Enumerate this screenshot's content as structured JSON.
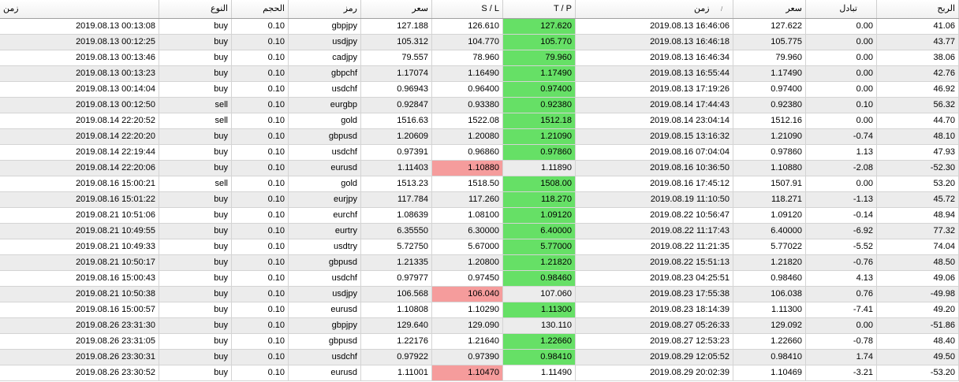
{
  "headers": {
    "open_time": "زمن",
    "type": "النوع",
    "volume": "الحجم",
    "symbol": "رمز",
    "open_price": "سعر",
    "sl": "S / L",
    "tp": "T / P",
    "close_time": "زمن",
    "close_price": "سعر",
    "swap": "تبادل",
    "profit": "الربح"
  },
  "sort_indicator": "/",
  "colors": {
    "tp_hit": "#66e066",
    "sl_hit": "#f59c9c",
    "alt_row": "#ececec"
  },
  "rows": [
    {
      "open_time": "2019.08.13 00:13:08",
      "type": "buy",
      "volume": "0.10",
      "symbol": "gbpjpy",
      "open_price": "127.188",
      "sl": "126.610",
      "tp": "127.620",
      "close_time": "2019.08.13 16:46:06",
      "close_price": "127.622",
      "swap": "0.00",
      "profit": "41.06",
      "hit": "tp"
    },
    {
      "open_time": "2019.08.13 00:12:25",
      "type": "buy",
      "volume": "0.10",
      "symbol": "usdjpy",
      "open_price": "105.312",
      "sl": "104.770",
      "tp": "105.770",
      "close_time": "2019.08.13 16:46:18",
      "close_price": "105.775",
      "swap": "0.00",
      "profit": "43.77",
      "hit": "tp"
    },
    {
      "open_time": "2019.08.13 00:13:46",
      "type": "buy",
      "volume": "0.10",
      "symbol": "cadjpy",
      "open_price": "79.557",
      "sl": "78.960",
      "tp": "79.960",
      "close_time": "2019.08.13 16:46:34",
      "close_price": "79.960",
      "swap": "0.00",
      "profit": "38.06",
      "hit": "tp"
    },
    {
      "open_time": "2019.08.13 00:13:23",
      "type": "buy",
      "volume": "0.10",
      "symbol": "gbpchf",
      "open_price": "1.17074",
      "sl": "1.16490",
      "tp": "1.17490",
      "close_time": "2019.08.13 16:55:44",
      "close_price": "1.17490",
      "swap": "0.00",
      "profit": "42.76",
      "hit": "tp"
    },
    {
      "open_time": "2019.08.13 00:14:04",
      "type": "buy",
      "volume": "0.10",
      "symbol": "usdchf",
      "open_price": "0.96943",
      "sl": "0.96400",
      "tp": "0.97400",
      "close_time": "2019.08.13 17:19:26",
      "close_price": "0.97400",
      "swap": "0.00",
      "profit": "46.92",
      "hit": "tp"
    },
    {
      "open_time": "2019.08.13 00:12:50",
      "type": "sell",
      "volume": "0.10",
      "symbol": "eurgbp",
      "open_price": "0.92847",
      "sl": "0.93380",
      "tp": "0.92380",
      "close_time": "2019.08.14 17:44:43",
      "close_price": "0.92380",
      "swap": "0.10",
      "profit": "56.32",
      "hit": "tp"
    },
    {
      "open_time": "2019.08.14 22:20:52",
      "type": "sell",
      "volume": "0.10",
      "symbol": "gold",
      "open_price": "1516.63",
      "sl": "1522.08",
      "tp": "1512.18",
      "close_time": "2019.08.14 23:04:14",
      "close_price": "1512.16",
      "swap": "0.00",
      "profit": "44.70",
      "hit": "tp"
    },
    {
      "open_time": "2019.08.14 22:20:20",
      "type": "buy",
      "volume": "0.10",
      "symbol": "gbpusd",
      "open_price": "1.20609",
      "sl": "1.20080",
      "tp": "1.21090",
      "close_time": "2019.08.15 13:16:32",
      "close_price": "1.21090",
      "swap": "-0.74",
      "profit": "48.10",
      "hit": "tp"
    },
    {
      "open_time": "2019.08.14 22:19:44",
      "type": "buy",
      "volume": "0.10",
      "symbol": "usdchf",
      "open_price": "0.97391",
      "sl": "0.96860",
      "tp": "0.97860",
      "close_time": "2019.08.16 07:04:04",
      "close_price": "0.97860",
      "swap": "1.13",
      "profit": "47.93",
      "hit": "tp"
    },
    {
      "open_time": "2019.08.14 22:20:06",
      "type": "buy",
      "volume": "0.10",
      "symbol": "eurusd",
      "open_price": "1.11403",
      "sl": "1.10880",
      "tp": "1.11890",
      "close_time": "2019.08.16 10:36:50",
      "close_price": "1.10880",
      "swap": "-2.08",
      "profit": "-52.30",
      "hit": "sl"
    },
    {
      "open_time": "2019.08.16 15:00:21",
      "type": "sell",
      "volume": "0.10",
      "symbol": "gold",
      "open_price": "1513.23",
      "sl": "1518.50",
      "tp": "1508.00",
      "close_time": "2019.08.16 17:45:12",
      "close_price": "1507.91",
      "swap": "0.00",
      "profit": "53.20",
      "hit": "tp"
    },
    {
      "open_time": "2019.08.16 15:01:22",
      "type": "buy",
      "volume": "0.10",
      "symbol": "eurjpy",
      "open_price": "117.784",
      "sl": "117.260",
      "tp": "118.270",
      "close_time": "2019.08.19 11:10:50",
      "close_price": "118.271",
      "swap": "-1.13",
      "profit": "45.72",
      "hit": "tp"
    },
    {
      "open_time": "2019.08.21 10:51:06",
      "type": "buy",
      "volume": "0.10",
      "symbol": "eurchf",
      "open_price": "1.08639",
      "sl": "1.08100",
      "tp": "1.09120",
      "close_time": "2019.08.22 10:56:47",
      "close_price": "1.09120",
      "swap": "-0.14",
      "profit": "48.94",
      "hit": "tp"
    },
    {
      "open_time": "2019.08.21 10:49:55",
      "type": "buy",
      "volume": "0.10",
      "symbol": "eurtry",
      "open_price": "6.35550",
      "sl": "6.30000",
      "tp": "6.40000",
      "close_time": "2019.08.22 11:17:43",
      "close_price": "6.40000",
      "swap": "-6.92",
      "profit": "77.32",
      "hit": "tp"
    },
    {
      "open_time": "2019.08.21 10:49:33",
      "type": "buy",
      "volume": "0.10",
      "symbol": "usdtry",
      "open_price": "5.72750",
      "sl": "5.67000",
      "tp": "5.77000",
      "close_time": "2019.08.22 11:21:35",
      "close_price": "5.77022",
      "swap": "-5.52",
      "profit": "74.04",
      "hit": "tp"
    },
    {
      "open_time": "2019.08.21 10:50:17",
      "type": "buy",
      "volume": "0.10",
      "symbol": "gbpusd",
      "open_price": "1.21335",
      "sl": "1.20800",
      "tp": "1.21820",
      "close_time": "2019.08.22 15:51:13",
      "close_price": "1.21820",
      "swap": "-0.76",
      "profit": "48.50",
      "hit": "tp"
    },
    {
      "open_time": "2019.08.16 15:00:43",
      "type": "buy",
      "volume": "0.10",
      "symbol": "usdchf",
      "open_price": "0.97977",
      "sl": "0.97450",
      "tp": "0.98460",
      "close_time": "2019.08.23 04:25:51",
      "close_price": "0.98460",
      "swap": "4.13",
      "profit": "49.06",
      "hit": "tp"
    },
    {
      "open_time": "2019.08.21 10:50:38",
      "type": "buy",
      "volume": "0.10",
      "symbol": "usdjpy",
      "open_price": "106.568",
      "sl": "106.040",
      "tp": "107.060",
      "close_time": "2019.08.23 17:55:38",
      "close_price": "106.038",
      "swap": "0.76",
      "profit": "-49.98",
      "hit": "sl"
    },
    {
      "open_time": "2019.08.16 15:00:57",
      "type": "buy",
      "volume": "0.10",
      "symbol": "eurusd",
      "open_price": "1.10808",
      "sl": "1.10290",
      "tp": "1.11300",
      "close_time": "2019.08.23 18:14:39",
      "close_price": "1.11300",
      "swap": "-7.41",
      "profit": "49.20",
      "hit": "tp"
    },
    {
      "open_time": "2019.08.26 23:31:30",
      "type": "buy",
      "volume": "0.10",
      "symbol": "gbpjpy",
      "open_price": "129.640",
      "sl": "129.090",
      "tp": "130.110",
      "close_time": "2019.08.27 05:26:33",
      "close_price": "129.092",
      "swap": "0.00",
      "profit": "-51.86",
      "hit": "none"
    },
    {
      "open_time": "2019.08.26 23:31:05",
      "type": "buy",
      "volume": "0.10",
      "symbol": "gbpusd",
      "open_price": "1.22176",
      "sl": "1.21640",
      "tp": "1.22660",
      "close_time": "2019.08.27 12:53:23",
      "close_price": "1.22660",
      "swap": "-0.78",
      "profit": "48.40",
      "hit": "tp"
    },
    {
      "open_time": "2019.08.26 23:30:31",
      "type": "buy",
      "volume": "0.10",
      "symbol": "usdchf",
      "open_price": "0.97922",
      "sl": "0.97390",
      "tp": "0.98410",
      "close_time": "2019.08.29 12:05:52",
      "close_price": "0.98410",
      "swap": "1.74",
      "profit": "49.50",
      "hit": "tp"
    },
    {
      "open_time": "2019.08.26 23:30:52",
      "type": "buy",
      "volume": "0.10",
      "symbol": "eurusd",
      "open_price": "1.11001",
      "sl": "1.10470",
      "tp": "1.11490",
      "close_time": "2019.08.29 20:02:39",
      "close_price": "1.10469",
      "swap": "-3.21",
      "profit": "-53.20",
      "hit": "sl"
    }
  ]
}
